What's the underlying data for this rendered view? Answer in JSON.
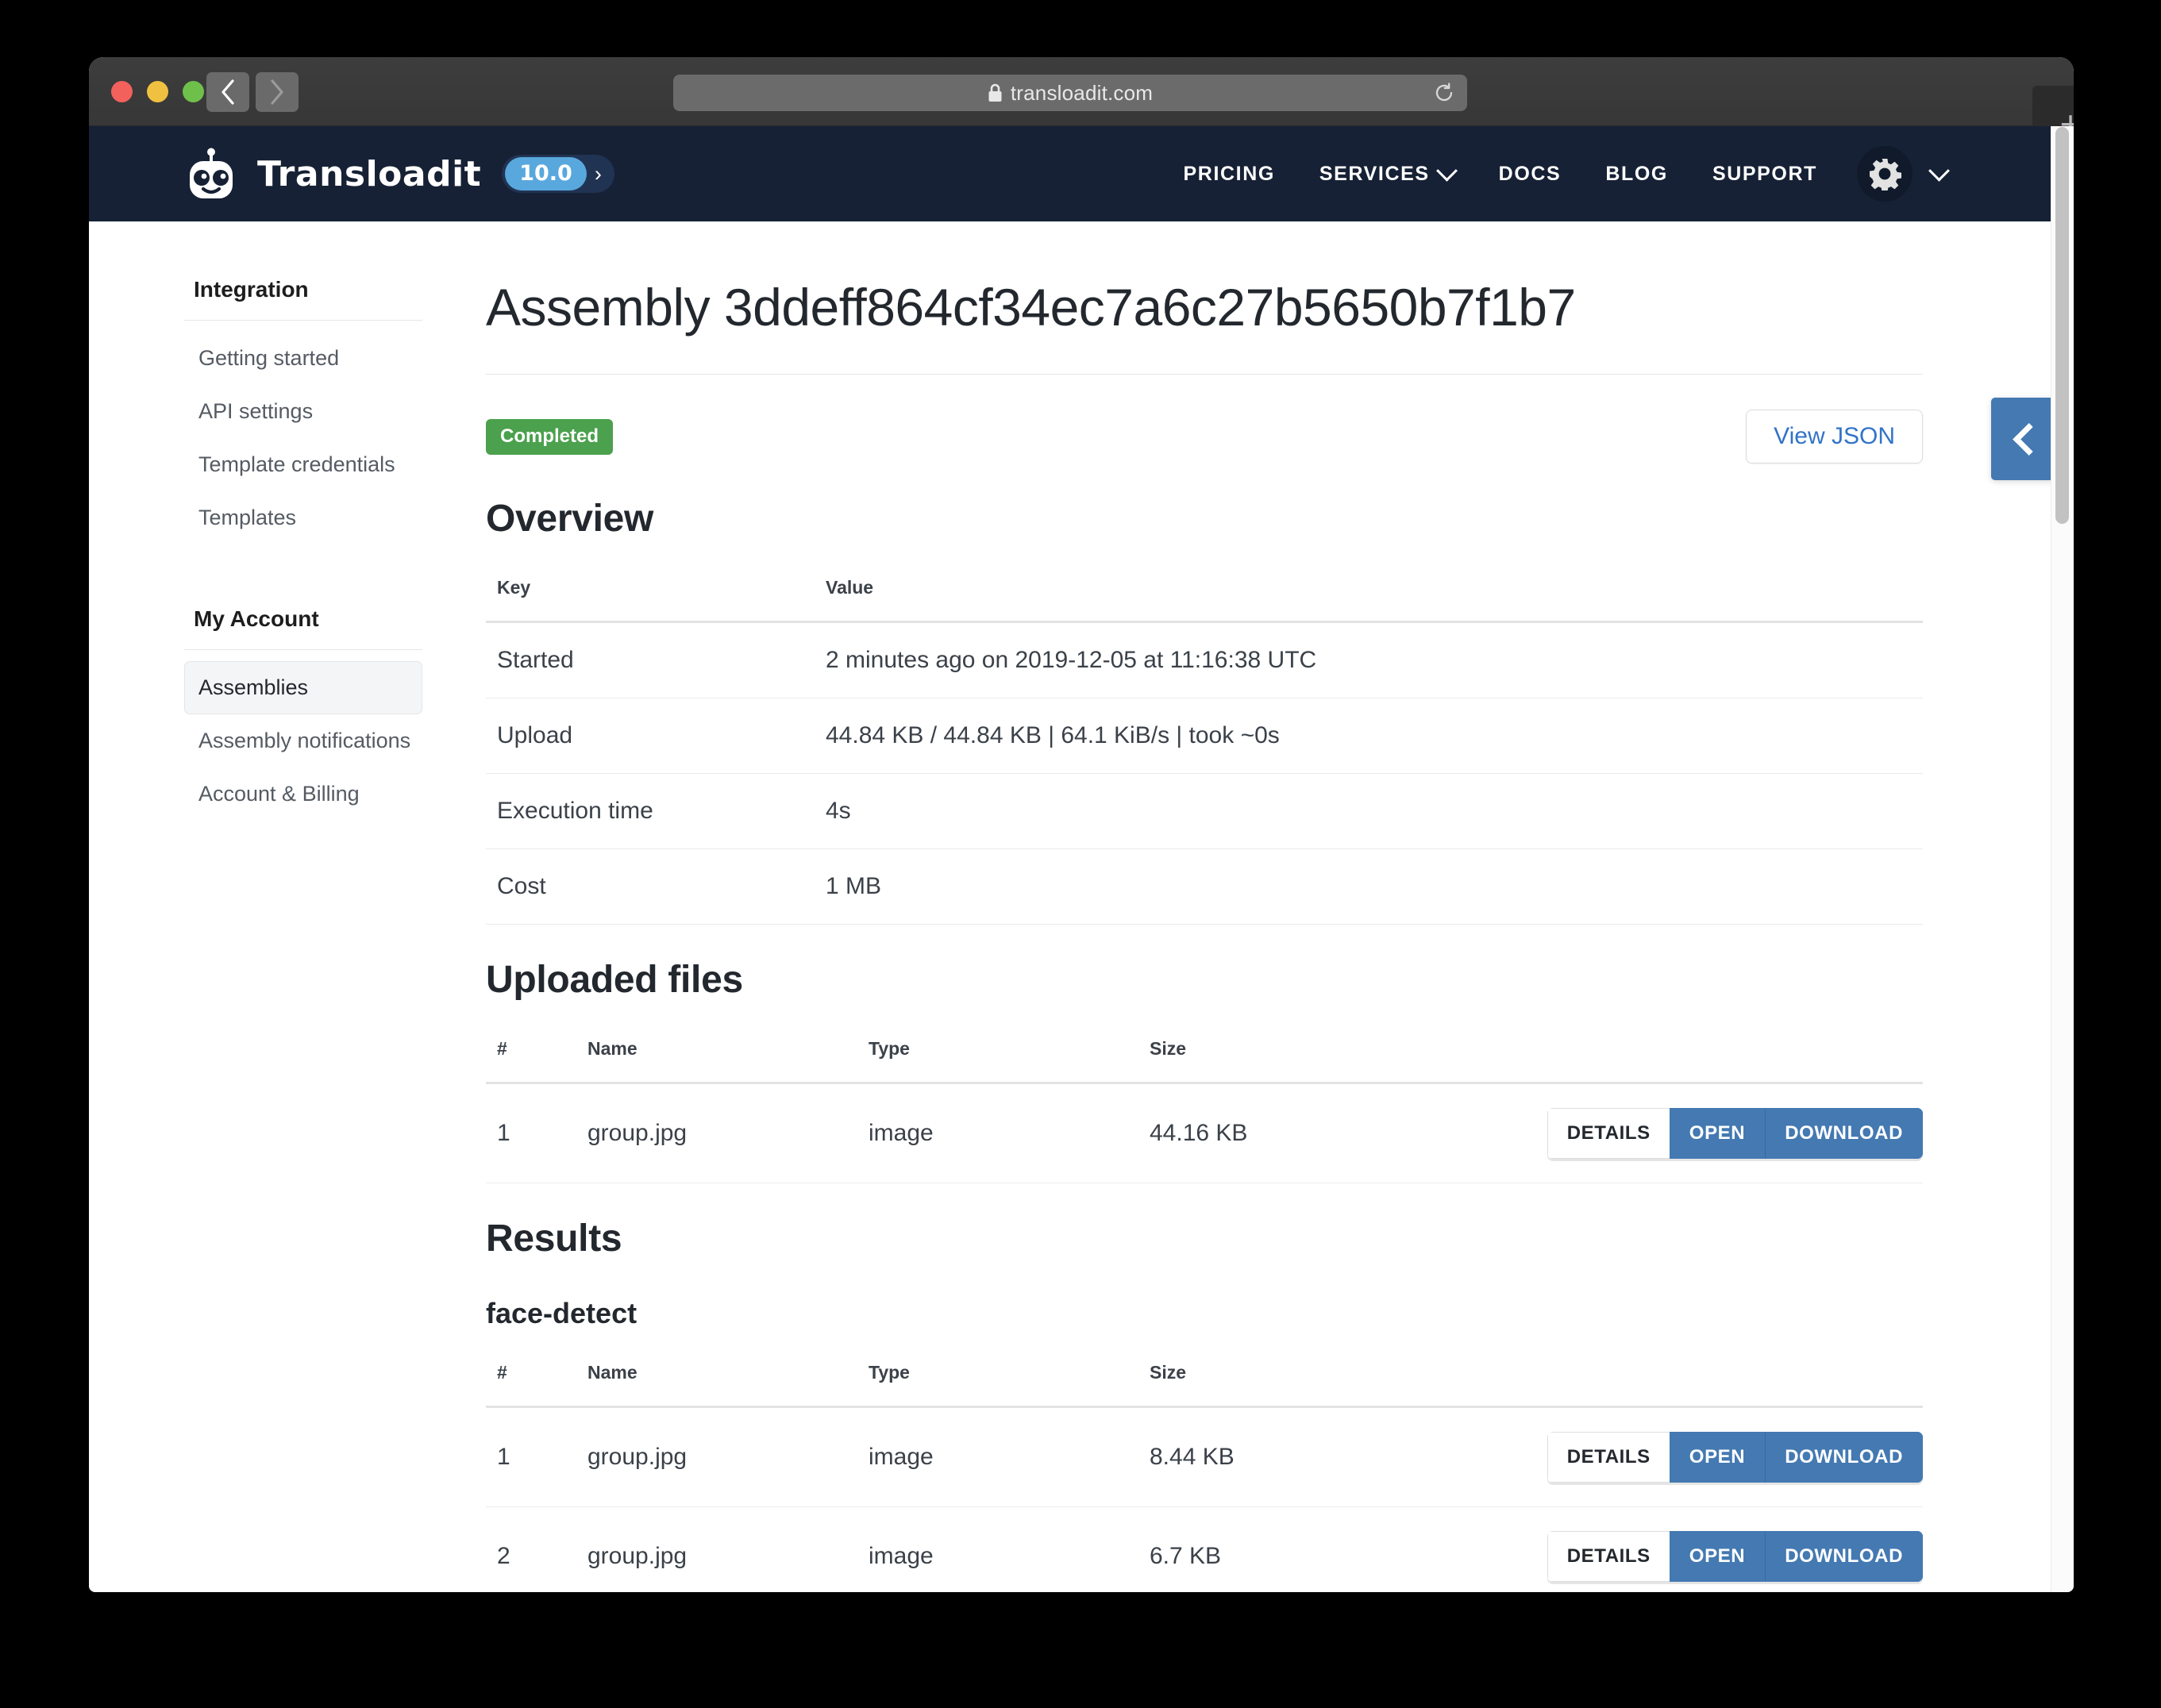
{
  "browser": {
    "url": "transloadit.com",
    "lock_icon": "lock-icon",
    "back_icon": "chevron-left-icon",
    "forward_icon": "chevron-right-icon",
    "reload_icon": "reload-icon",
    "new_tab_label": "+"
  },
  "site_header": {
    "brand_name": "Transloadit",
    "version_badge": "10.0",
    "version_chevron": "›",
    "logo_icon": "robot-logo-icon",
    "nav": [
      {
        "label": "PRICING",
        "has_chevron": false
      },
      {
        "label": "SERVICES",
        "has_chevron": true
      },
      {
        "label": "DOCS",
        "has_chevron": false
      },
      {
        "label": "BLOG",
        "has_chevron": false
      },
      {
        "label": "SUPPORT",
        "has_chevron": false
      }
    ],
    "gear_icon": "gear-icon",
    "gear_chevron_icon": "chevron-down-icon"
  },
  "sidebar": {
    "groups": [
      {
        "title": "Integration",
        "items": [
          {
            "label": "Getting started",
            "active": false
          },
          {
            "label": "API settings",
            "active": false
          },
          {
            "label": "Template credentials",
            "active": false
          },
          {
            "label": "Templates",
            "active": false
          }
        ]
      },
      {
        "title": "My Account",
        "items": [
          {
            "label": "Assemblies",
            "active": true
          },
          {
            "label": "Assembly notifications",
            "active": false
          },
          {
            "label": "Account & Billing",
            "active": false
          }
        ]
      }
    ]
  },
  "main": {
    "page_title": "Assembly 3ddeff864cf34ec7a6c27b5650b7f1b7",
    "status_badge": "Completed",
    "view_json_label": "View JSON",
    "overview": {
      "heading": "Overview",
      "columns": [
        "Key",
        "Value"
      ],
      "rows": [
        {
          "key": "Started",
          "value": "2 minutes ago on 2019-12-05 at 11:16:38 UTC"
        },
        {
          "key": "Upload",
          "value": "44.84 KB / 44.84 KB | 64.1 KiB/s | took ~0s"
        },
        {
          "key": "Execution time",
          "value": "4s"
        },
        {
          "key": "Cost",
          "value": "1 MB"
        }
      ]
    },
    "uploaded_files": {
      "heading": "Uploaded files",
      "columns": [
        "#",
        "Name",
        "Type",
        "Size"
      ],
      "actions": [
        "DETAILS",
        "OPEN",
        "DOWNLOAD"
      ],
      "rows": [
        {
          "num": "1",
          "name": "group.jpg",
          "type": "image",
          "size": "44.16 KB"
        }
      ]
    },
    "results": {
      "heading": "Results",
      "steps": [
        {
          "name": "face-detect",
          "columns": [
            "#",
            "Name",
            "Type",
            "Size"
          ],
          "actions": [
            "DETAILS",
            "OPEN",
            "DOWNLOAD"
          ],
          "rows": [
            {
              "num": "1",
              "name": "group.jpg",
              "type": "image",
              "size": "8.44 KB"
            },
            {
              "num": "2",
              "name": "group.jpg",
              "type": "image",
              "size": "6.7 KB"
            }
          ]
        }
      ]
    },
    "side_tab_icon": "chevron-left-icon"
  },
  "colors": {
    "header_bg": "#162135",
    "accent_blue": "#4479b2",
    "link_blue": "#3273c8",
    "success_green": "#4ba14d",
    "badge_blue": "#59a8dd"
  }
}
